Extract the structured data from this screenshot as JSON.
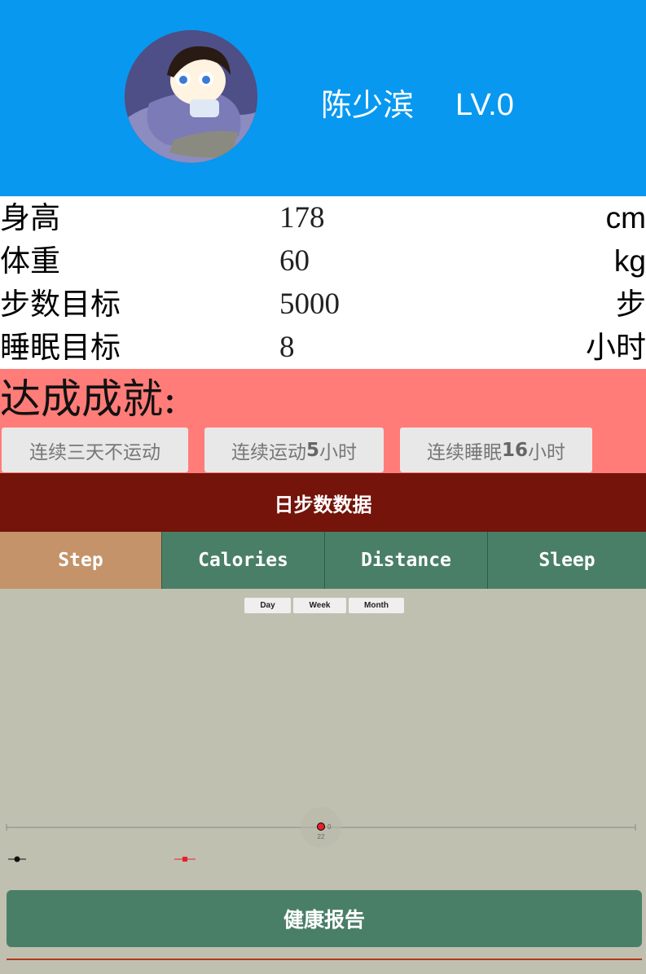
{
  "header": {
    "user_name": "陈少滨",
    "level": "LV.0",
    "background": "#0898f0"
  },
  "profile": [
    {
      "label": "身高",
      "value": "178",
      "unit": "cm"
    },
    {
      "label": "体重",
      "value": "60",
      "unit": "kg"
    },
    {
      "label": "步数目标",
      "value": "5000",
      "unit": "步"
    },
    {
      "label": "睡眠目标",
      "value": "8",
      "unit": "小时"
    }
  ],
  "achievements": {
    "title": "达成成就:",
    "badges": [
      {
        "text": "连续三天不运动"
      },
      {
        "pre": "连续运动",
        "num": "5",
        "post": "小时"
      },
      {
        "pre": "连续睡眠",
        "num": "16",
        "post": "小时"
      }
    ]
  },
  "data_section": {
    "title": "日步数数据"
  },
  "tabs": [
    {
      "label": "Step",
      "active": true
    },
    {
      "label": "Calories",
      "active": false
    },
    {
      "label": "Distance",
      "active": false
    },
    {
      "label": "Sleep",
      "active": false
    }
  ],
  "range_buttons": [
    "Day",
    "Week",
    "Month"
  ],
  "chart_data": {
    "type": "line",
    "x": [
      "22"
    ],
    "series": [
      {
        "values": [
          0
        ],
        "color": "#000000"
      },
      {
        "values": [
          0
        ],
        "color": "#e8202a"
      }
    ],
    "point_label": "0",
    "legend_placement": "bottom-left"
  },
  "report_button": {
    "label": "健康报告"
  },
  "colors": {
    "achievement_bg": "#ff7c78",
    "data_header_bg": "#74140a",
    "tab_bg": "#4a7f67",
    "tab_active_bg": "#c4936a",
    "chart_bg": "#c0c0b0"
  }
}
